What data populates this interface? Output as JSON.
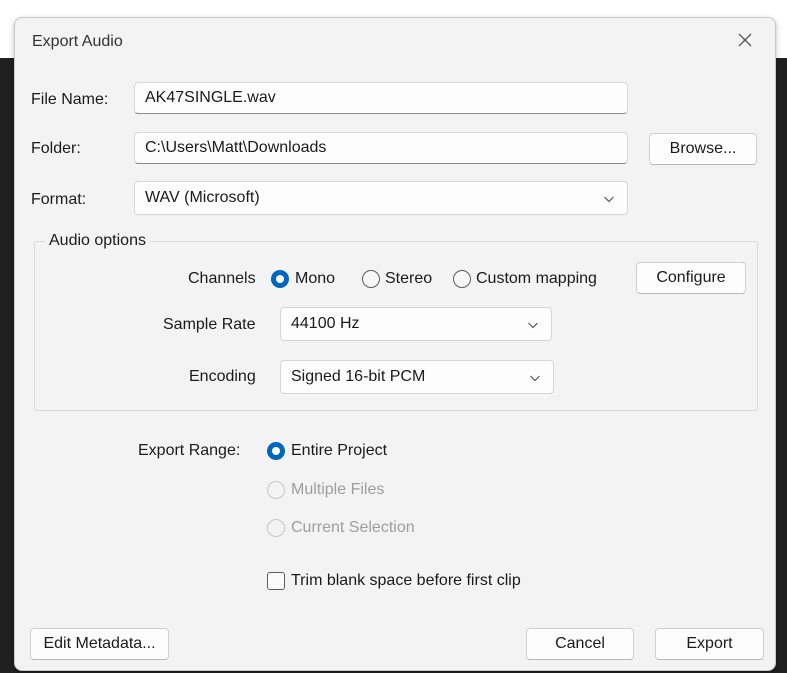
{
  "dialog": {
    "title": "Export Audio",
    "close_icon": "close-icon"
  },
  "file_name": {
    "label": "File Name:",
    "value": "AK47SINGLE.wav"
  },
  "folder": {
    "label": "Folder:",
    "value": "C:\\Users\\Matt\\Downloads",
    "browse_label": "Browse..."
  },
  "format": {
    "label": "Format:",
    "value": "WAV (Microsoft)"
  },
  "audio_options": {
    "title": "Audio options",
    "channels": {
      "label": "Channels",
      "options": [
        "Mono",
        "Stereo",
        "Custom mapping"
      ],
      "selected": "Mono"
    },
    "configure_label": "Configure",
    "sample_rate": {
      "label": "Sample Rate",
      "value": "44100 Hz"
    },
    "encoding": {
      "label": "Encoding",
      "value": "Signed 16-bit PCM"
    }
  },
  "export_range": {
    "label": "Export Range:",
    "options": [
      "Entire Project",
      "Multiple Files",
      "Current Selection"
    ],
    "selected": "Entire Project",
    "disabled": [
      "Multiple Files",
      "Current Selection"
    ]
  },
  "trim": {
    "label": "Trim blank space before first clip",
    "checked": false
  },
  "buttons": {
    "edit_metadata": "Edit Metadata...",
    "cancel": "Cancel",
    "export": "Export"
  },
  "colors": {
    "accent": "#0067c0",
    "dialog_bg": "#f3f3f3",
    "disabled_text": "#9e9e9e"
  }
}
